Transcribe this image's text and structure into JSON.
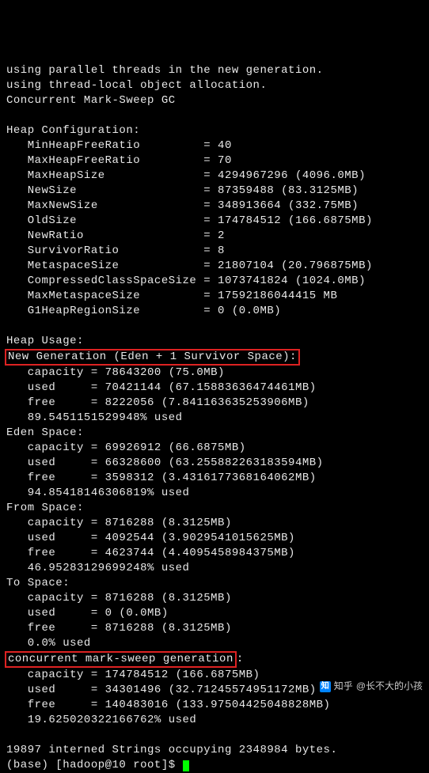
{
  "lines": {
    "l1": "using parallel threads in the new generation.",
    "l2": "using thread-local object allocation.",
    "l3": "Concurrent Mark-Sweep GC",
    "l4": "",
    "l5": "Heap Configuration:",
    "l6": "   MinHeapFreeRatio         = 40",
    "l7": "   MaxHeapFreeRatio         = 70",
    "l8": "   MaxHeapSize              = 4294967296 (4096.0MB)",
    "l9": "   NewSize                  = 87359488 (83.3125MB)",
    "l10": "   MaxNewSize               = 348913664 (332.75MB)",
    "l11": "   OldSize                  = 174784512 (166.6875MB)",
    "l12": "   NewRatio                 = 2",
    "l13": "   SurvivorRatio            = 8",
    "l14": "   MetaspaceSize            = 21807104 (20.796875MB)",
    "l15": "   CompressedClassSpaceSize = 1073741824 (1024.0MB)",
    "l16": "   MaxMetaspaceSize         = 17592186044415 MB",
    "l17": "   G1HeapRegionSize         = 0 (0.0MB)",
    "l18": "",
    "l19": "Heap Usage:",
    "l20": "New Generation (Eden + 1 Survivor Space):",
    "l21": "   capacity = 78643200 (75.0MB)",
    "l22": "   used     = 70421144 (67.15883636474461MB)",
    "l23": "   free     = 8222056 (7.841163635253906MB)",
    "l24": "   89.5451151529948% used",
    "l25": "Eden Space:",
    "l26": "   capacity = 69926912 (66.6875MB)",
    "l27": "   used     = 66328600 (63.255882263183594MB)",
    "l28": "   free     = 3598312 (3.4316177368164062MB)",
    "l29": "   94.85418146306819% used",
    "l30": "From Space:",
    "l31": "   capacity = 8716288 (8.3125MB)",
    "l32": "   used     = 4092544 (3.9029541015625MB)",
    "l33": "   free     = 4623744 (4.4095458984375MB)",
    "l34": "   46.95283129699248% used",
    "l35": "To Space:",
    "l36": "   capacity = 8716288 (8.3125MB)",
    "l37": "   used     = 0 (0.0MB)",
    "l38": "   free     = 8716288 (8.3125MB)",
    "l39": "   0.0% used",
    "l40": "concurrent mark-sweep generation",
    "l40b": ":",
    "l41": "   capacity = 174784512 (166.6875MB)",
    "l42": "   used     = 34301496 (32.71245574951172MB)",
    "l43": "   free     = 140483016 (133.97504425048828MB)",
    "l44": "   19.625020322166762% used",
    "l45": "",
    "l46": "19897 interned Strings occupying 2348984 bytes.",
    "l47a": "(base) [hadoop@10 root]$ "
  },
  "watermark": {
    "brand": "知乎",
    "at": "@长不大的小孩",
    "icon": "知"
  }
}
